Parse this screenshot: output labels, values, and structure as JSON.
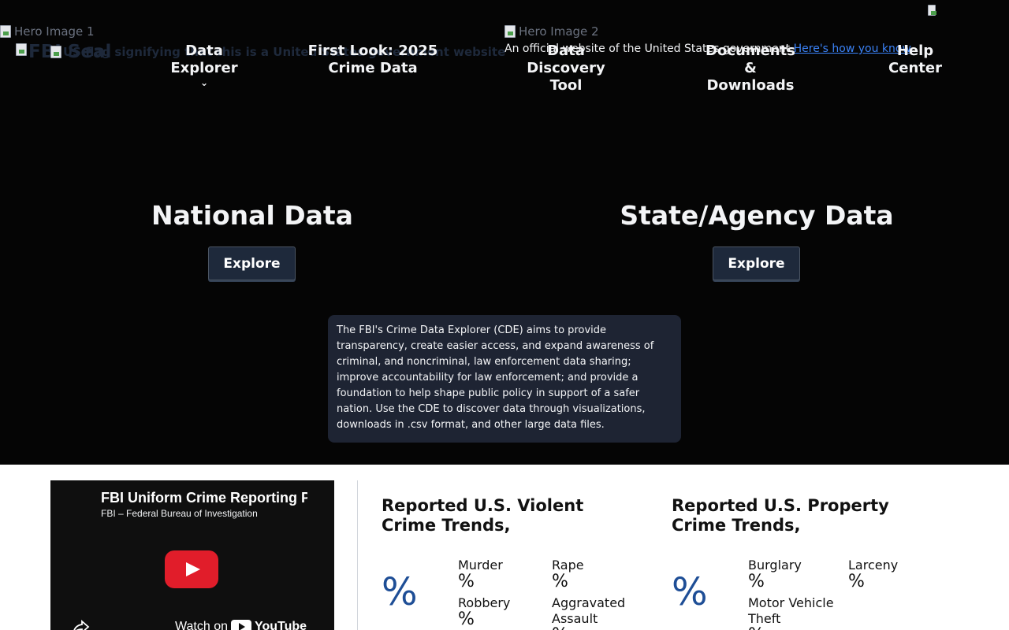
{
  "hero": {
    "image1_alt": "Hero Image 1",
    "image2_alt": "Hero Image 2"
  },
  "banner": {
    "text": "An official website of the United States government",
    "link": "Here's how you know"
  },
  "header": {
    "seal_alt": "FBI Seal",
    "flag_alt": "US flag signifying that this is a United States government website"
  },
  "nav": {
    "items": [
      {
        "label": "Data Explorer",
        "chevron": "⌄"
      },
      {
        "label": "First Look: 2025 Crime Data"
      },
      {
        "label": "Data Discovery Tool"
      },
      {
        "label": "Documents & Downloads"
      },
      {
        "label": "Help Center"
      }
    ],
    "search_alt": "Here's how you know"
  },
  "sections": {
    "national": {
      "title": "National Data",
      "button": "Explore"
    },
    "state": {
      "title": "State/Agency Data",
      "button": "Explore"
    }
  },
  "about": {
    "text": "The FBI's Crime Data Explorer (CDE) aims to provide transparency, create easier access, and expand awareness of criminal, and noncriminal, law enforcement data sharing; improve accountability for law enforcement; and provide a foundation to help shape public policy in support of a safer nation. Use the CDE to discover data through visualizations, downloads in .csv format, and other large data files."
  },
  "video": {
    "title": "FBI Uniform Crime Reporting Program",
    "channel": "FBI – Federal Bureau of Investigation",
    "watch_on": "Watch on",
    "platform": "YouTube"
  },
  "violent": {
    "title": "Reported U.S. Violent Crime Trends,",
    "big_pct": "%",
    "items": [
      {
        "label": "Murder",
        "pct": "%"
      },
      {
        "label": "Rape",
        "pct": "%"
      },
      {
        "label": "Robbery",
        "pct": "%"
      },
      {
        "label": "Aggravated Assault",
        "pct": "%"
      }
    ]
  },
  "property": {
    "title": "Reported U.S. Property Crime Trends,",
    "big_pct": "%",
    "items": [
      {
        "label": "Burglary",
        "pct": "%"
      },
      {
        "label": "Larceny",
        "pct": "%"
      },
      {
        "label": "Motor Vehicle Theft",
        "pct": "%"
      }
    ]
  },
  "colors": {
    "hero_bg": "#050505",
    "button_bg": "#1e293b",
    "about_bg": "#1e2433",
    "accent_blue": "#1e4e96",
    "link_blue": "#3b82f6",
    "play_red": "#e11d2a"
  }
}
